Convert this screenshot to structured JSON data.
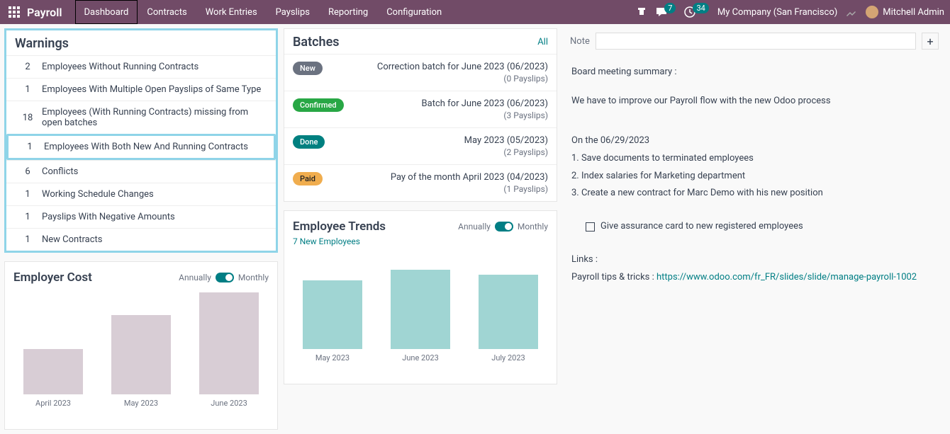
{
  "nav": {
    "brand": "Payroll",
    "tabs": [
      "Dashboard",
      "Contracts",
      "Work Entries",
      "Payslips",
      "Reporting",
      "Configuration"
    ],
    "activeTab": 0,
    "msgBadge": "7",
    "clockBadge": "34",
    "company": "My Company (San Francisco)",
    "user": "Mitchell Admin"
  },
  "warnings": {
    "title": "Warnings",
    "items": [
      {
        "count": "2",
        "label": "Employees Without Running Contracts"
      },
      {
        "count": "1",
        "label": "Employees With Multiple Open Payslips of Same Type"
      },
      {
        "count": "18",
        "label": "Employees (With Running Contracts) missing from open batches"
      },
      {
        "count": "1",
        "label": "Employees With Both New And Running Contracts"
      },
      {
        "count": "6",
        "label": "Conflicts"
      },
      {
        "count": "1",
        "label": "Working Schedule Changes"
      },
      {
        "count": "1",
        "label": "Payslips With Negative Amounts"
      },
      {
        "count": "1",
        "label": "New Contracts"
      }
    ]
  },
  "batches": {
    "title": "Batches",
    "allLabel": "All",
    "items": [
      {
        "status": "New",
        "statusClass": "status-new",
        "title": "Correction batch for June 2023 (06/2023)",
        "sub": "(0 Payslips)"
      },
      {
        "status": "Confirmed",
        "statusClass": "status-confirmed",
        "title": "Batch for June 2023 (06/2023)",
        "sub": "(3 Payslips)"
      },
      {
        "status": "Done",
        "statusClass": "status-done",
        "title": "May 2023 (05/2023)",
        "sub": "(2 Payslips)"
      },
      {
        "status": "Paid",
        "statusClass": "status-paid",
        "title": "Pay of the month April 2023 (04/2023)",
        "sub": "(1 Payslips)"
      }
    ]
  },
  "employerCost": {
    "title": "Employer Cost",
    "annually": "Annually",
    "monthly": "Monthly"
  },
  "employeeTrends": {
    "title": "Employee Trends",
    "annually": "Annually",
    "monthly": "Monthly",
    "link": "7 New Employees"
  },
  "notes": {
    "label": "Note",
    "body": {
      "l1": "Board meeting summary :",
      "l2": "We have to improve our Payroll flow with the new Odoo process",
      "l3": "On the 06/29/2023",
      "l4": "1. Save documents to terminated employees",
      "l5": "2. Index salaries for Marketing department",
      "l6": "3. Create a new contract for Marc Demo with his new position",
      "cb": "Give assurance card to new registered employees",
      "l7": "Links :",
      "l8a": "Payroll tips & tricks : ",
      "l8b": "https://www.odoo.com/fr_FR/slides/slide/manage-payroll-1002"
    }
  },
  "chart_data": [
    {
      "type": "bar",
      "title": "Employer Cost",
      "categories": [
        "April 2023",
        "May 2023",
        "June 2023"
      ],
      "values": [
        40,
        70,
        90
      ],
      "color": "#d8cdd5",
      "note": "values are relative heights (no y-axis shown)"
    },
    {
      "type": "bar",
      "title": "Employee Trends",
      "categories": [
        "May 2023",
        "June 2023",
        "July 2023"
      ],
      "values": [
        65,
        75,
        70
      ],
      "color": "#a0d5d3",
      "note": "values are relative heights (no y-axis shown)"
    }
  ]
}
